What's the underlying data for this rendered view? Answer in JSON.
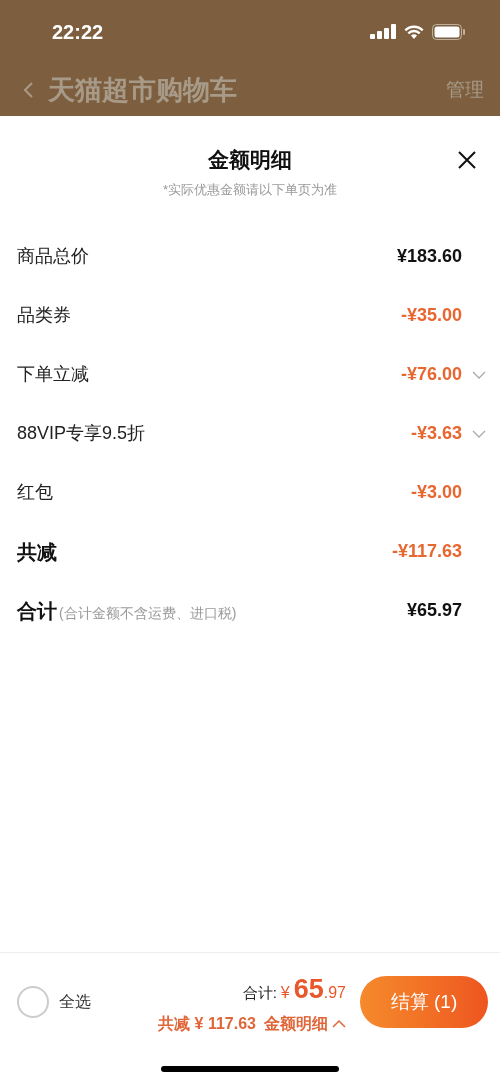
{
  "status_bar": {
    "time": "22:22"
  },
  "nav_bar": {
    "title": "天猫超市购物车",
    "action": "管理"
  },
  "sheet": {
    "title": "金额明细",
    "subtitle": "*实际优惠金额请以下单页为准",
    "rows": [
      {
        "kind": "plain",
        "label": "商品总价",
        "amount": "¥183.60",
        "expandable": false
      },
      {
        "kind": "discount",
        "label": "品类券",
        "amount": "-¥35.00",
        "expandable": false
      },
      {
        "kind": "discount",
        "label": "下单立减",
        "amount": "-¥76.00",
        "expandable": true
      },
      {
        "kind": "discount",
        "label": "88VIP专享9.5折",
        "amount": "-¥3.63",
        "expandable": true
      },
      {
        "kind": "discount",
        "label": "红包",
        "amount": "-¥3.00",
        "expandable": false
      },
      {
        "kind": "total_discount",
        "label": "共减",
        "amount": "-¥117.63",
        "expandable": false
      },
      {
        "kind": "total",
        "label": "合计",
        "note": "(合计金额不含运费、进口税)",
        "amount": "¥65.97",
        "expandable": false
      }
    ]
  },
  "bottom_bar": {
    "select_all": {
      "label": "全选",
      "checked": false
    },
    "total_label": "合计:",
    "total_currency": "¥",
    "total_integer": "65",
    "total_decimal": ".97",
    "saved": "共减 ¥ 117.63",
    "details_link": "金额明细",
    "checkout": "结算 (1)"
  }
}
